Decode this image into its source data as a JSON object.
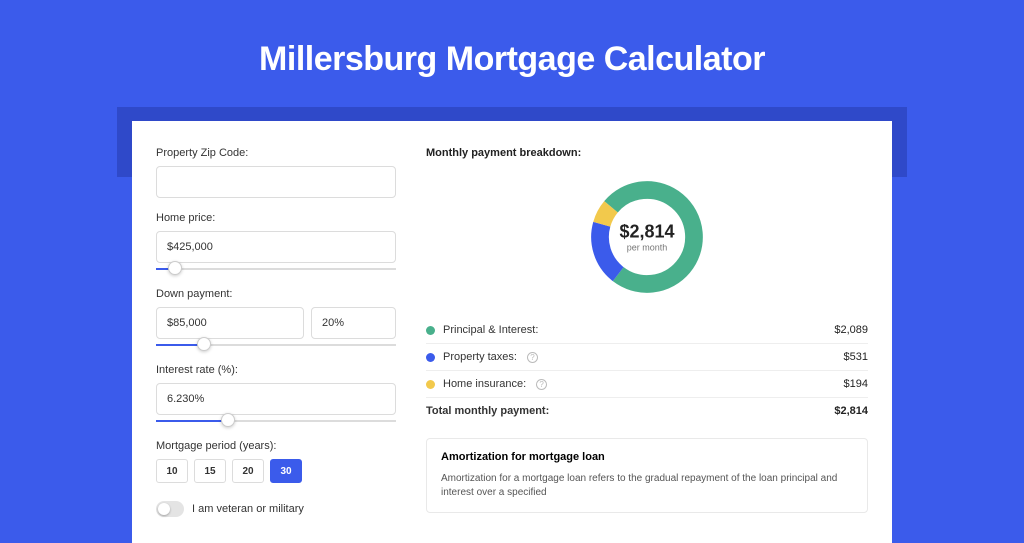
{
  "title": "Millersburg Mortgage Calculator",
  "form": {
    "zip": {
      "label": "Property Zip Code:",
      "value": ""
    },
    "price": {
      "label": "Home price:",
      "value": "$425,000",
      "slider_pct": 8
    },
    "down": {
      "label": "Down payment:",
      "value": "$85,000",
      "pct_value": "20%",
      "slider_pct": 20
    },
    "rate": {
      "label": "Interest rate (%):",
      "value": "6.230%",
      "slider_pct": 30
    },
    "period": {
      "label": "Mortgage period (years):",
      "options": [
        "10",
        "15",
        "20",
        "30"
      ],
      "selected": "30"
    },
    "veteran": {
      "label": "I am veteran or military",
      "on": false
    }
  },
  "breakdown": {
    "header": "Monthly payment breakdown:",
    "center_amount": "$2,814",
    "center_sub": "per month",
    "rows": [
      {
        "label": "Principal & Interest:",
        "value": "$2,089",
        "color": "#49B08C",
        "help": false
      },
      {
        "label": "Property taxes:",
        "value": "$531",
        "color": "#3B5BEB",
        "help": true
      },
      {
        "label": "Home insurance:",
        "value": "$194",
        "color": "#F2C94C",
        "help": true
      }
    ],
    "total": {
      "label": "Total monthly payment:",
      "value": "$2,814"
    }
  },
  "amort": {
    "title": "Amortization for mortgage loan",
    "body": "Amortization for a mortgage loan refers to the gradual repayment of the loan principal and interest over a specified"
  },
  "chart_data": {
    "type": "pie",
    "title": "Monthly payment breakdown",
    "donut": true,
    "total": 2814,
    "series": [
      {
        "name": "Principal & Interest",
        "value": 2089,
        "color": "#49B08C"
      },
      {
        "name": "Property taxes",
        "value": 531,
        "color": "#3B5BEB"
      },
      {
        "name": "Home insurance",
        "value": 194,
        "color": "#F2C94C"
      }
    ]
  }
}
